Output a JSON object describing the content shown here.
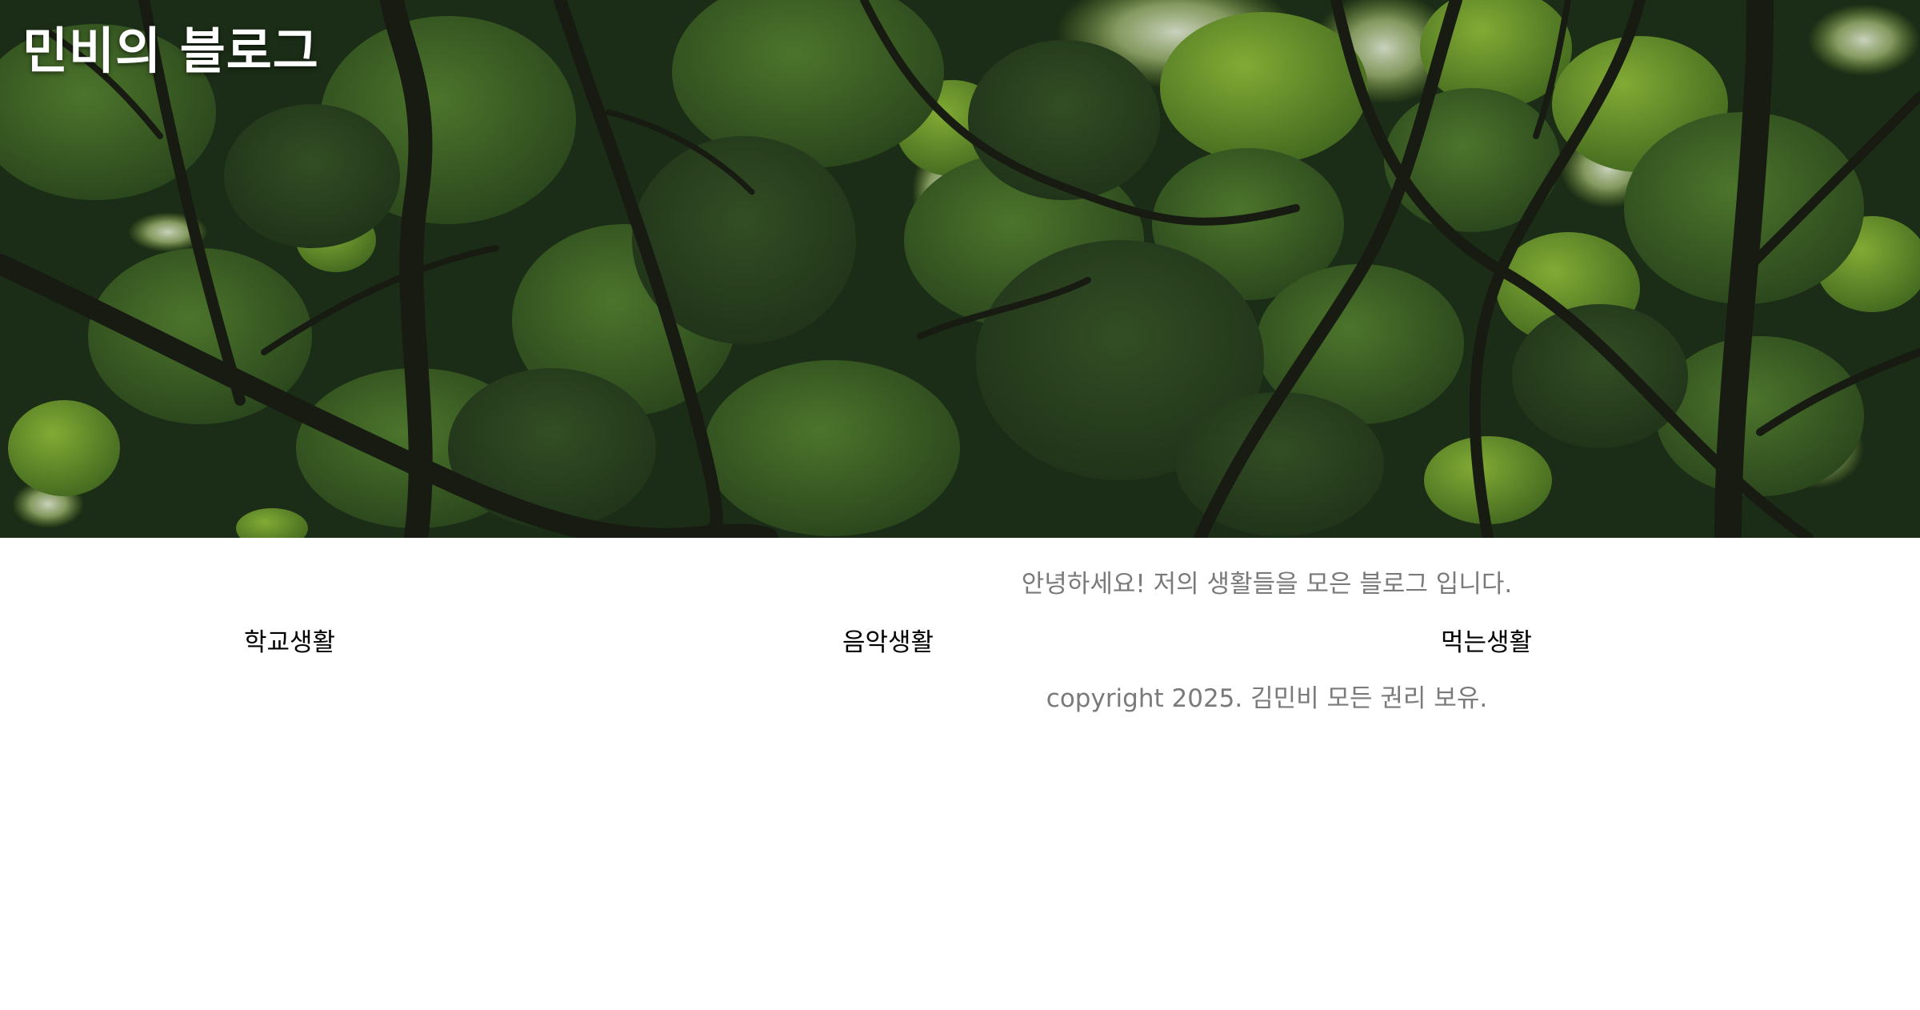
{
  "header": {
    "title": "민비의 블로그",
    "hero_image": "leafy-tree-canopy-photo"
  },
  "intro": {
    "text": "안녕하세요! 저의 생활들을 모은 블로그 입니다."
  },
  "nav": {
    "items": [
      {
        "label": "학교생활"
      },
      {
        "label": "음악생활"
      },
      {
        "label": "먹는생활"
      }
    ]
  },
  "footer": {
    "copyright": "copyright 2025. 김민비 모든 권리 보유."
  },
  "colors": {
    "text_muted": "#7a7a7a",
    "text_nav": "#000000",
    "title": "#ffffff",
    "background": "#ffffff",
    "foliage_dark": "#1b2f15",
    "foliage_light": "#a8cf46"
  }
}
